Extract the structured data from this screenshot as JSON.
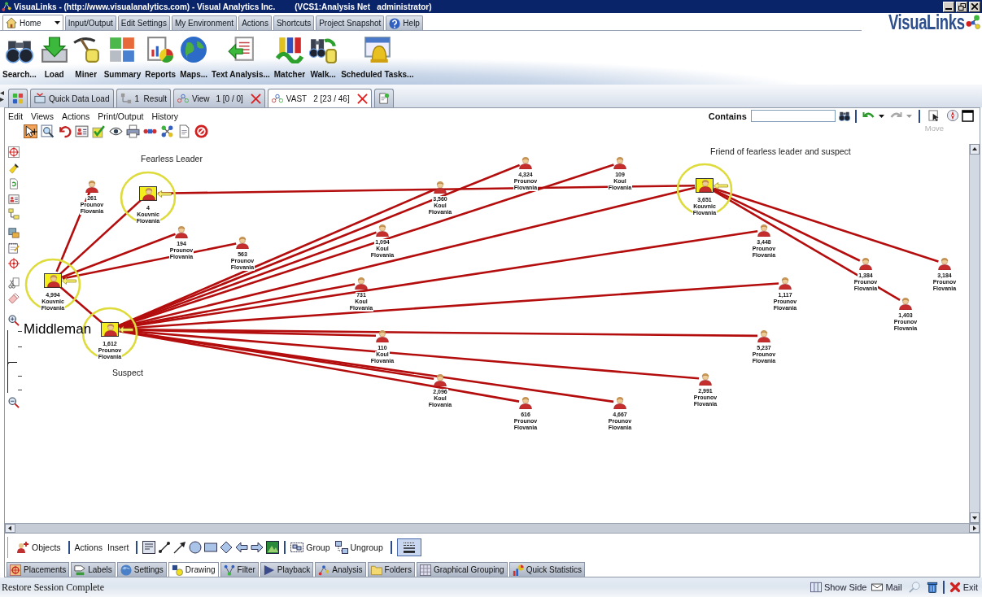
{
  "window": {
    "title": "VisuaLinks - (http://www.visualanalytics.com) - Visual Analytics Inc.",
    "session": "(VCS1:Analysis Net   administrator)"
  },
  "menu_tabs": [
    {
      "label": "Home",
      "kind": "home",
      "selected": true
    },
    {
      "label": "Input/Output",
      "kind": "plain",
      "selected": false
    },
    {
      "label": "Edit Settings",
      "kind": "plain",
      "selected": false
    },
    {
      "label": "My Environment",
      "kind": "plain",
      "selected": false
    },
    {
      "label": "Actions",
      "kind": "plain",
      "selected": false
    },
    {
      "label": "Shortcuts",
      "kind": "plain",
      "selected": false
    },
    {
      "label": "Project Snapshot",
      "kind": "plain",
      "selected": false
    },
    {
      "label": "Help",
      "kind": "help",
      "selected": false
    }
  ],
  "logo": "VisuaLinks",
  "ribbon": [
    {
      "label": "Search..."
    },
    {
      "label": "Load"
    },
    {
      "label": "Miner"
    },
    {
      "label": "Summary"
    },
    {
      "label": "Reports"
    },
    {
      "label": "Maps..."
    },
    {
      "label": "Text Analysis..."
    },
    {
      "label": "Matcher"
    },
    {
      "label": "Walk..."
    },
    {
      "label": "Scheduled Tasks..."
    }
  ],
  "document_tabs": [
    {
      "kind": "overview",
      "selected": false,
      "closable": false
    },
    {
      "kind": "load",
      "label": "Quick Data Load",
      "selected": false,
      "closable": false
    },
    {
      "kind": "result",
      "label": "1  Result",
      "selected": false,
      "closable": false
    },
    {
      "kind": "graph",
      "label": "View",
      "detail": "1 [0 / 0]",
      "selected": false,
      "closable": true
    },
    {
      "kind": "graph",
      "label": "VAST",
      "detail": "2 [23 / 46]",
      "selected": true,
      "closable": true
    },
    {
      "kind": "new",
      "selected": false,
      "closable": false
    }
  ],
  "graph_panel": {
    "menu": [
      "Edit",
      "Views",
      "Actions",
      "Print/Output",
      "History"
    ],
    "tools": [
      {
        "selected": true
      },
      {
        "selected": false
      },
      {
        "selected": false
      },
      {
        "selected": false
      },
      {
        "selected": false
      },
      {
        "selected": false
      },
      {
        "selected": false
      },
      {
        "selected": false
      },
      {
        "selected": false
      },
      {
        "selected": false
      },
      {
        "selected": false
      }
    ],
    "search": {
      "label": "Contains"
    },
    "history": [
      {
        "kind": "undo",
        "disabled": false
      },
      {
        "kind": "redo",
        "disabled": true
      }
    ],
    "move_button": {
      "label": "Move",
      "disabled": true
    },
    "zoom_slider": {
      "level": 0.46
    },
    "nodes": [
      {
        "value": "4,324",
        "name": "Prounov",
        "country": "Flovania",
        "selected": false
      },
      {
        "value": "109",
        "name": "Koul",
        "country": "Flovania",
        "selected": false
      },
      {
        "value": "261",
        "name": "Prounov",
        "country": "Flovania",
        "selected": false
      },
      {
        "value": "4",
        "name": "Kouvnic",
        "country": "Flovania",
        "selected": true
      },
      {
        "value": "3,560",
        "name": "Koul",
        "country": "Flovania",
        "selected": false
      },
      {
        "value": "3,651",
        "name": "Kouvnic",
        "country": "Flovania",
        "selected": true
      },
      {
        "value": "194",
        "name": "Prounov",
        "country": "Flovania",
        "selected": false
      },
      {
        "value": "563",
        "name": "Prounov",
        "country": "Flovania",
        "selected": false
      },
      {
        "value": "1,094",
        "name": "Koul",
        "country": "Flovania",
        "selected": false
      },
      {
        "value": "3,448",
        "name": "Prounov",
        "country": "Flovania",
        "selected": false
      },
      {
        "value": "1,384",
        "name": "Prounov",
        "country": "Flovania",
        "selected": false
      },
      {
        "value": "3,184",
        "name": "Prounov",
        "country": "Flovania",
        "selected": false
      },
      {
        "value": "4,994",
        "name": "Kouvnic",
        "country": "Flovania",
        "selected": true
      },
      {
        "value": "731",
        "name": "Koul",
        "country": "Flovania",
        "selected": false
      },
      {
        "value": "1,117",
        "name": "Prounov",
        "country": "Flovania",
        "selected": false
      },
      {
        "value": "1,403",
        "name": "Prounov",
        "country": "Flovania",
        "selected": false
      },
      {
        "value": "1,612",
        "name": "Prounov",
        "country": "Flovania",
        "selected": true
      },
      {
        "value": "110",
        "name": "Koul",
        "country": "Flovania",
        "selected": false
      },
      {
        "value": "5,237",
        "name": "Prounov",
        "country": "Flovania",
        "selected": false
      },
      {
        "value": "2,096",
        "name": "Koul",
        "country": "Flovania",
        "selected": false
      },
      {
        "value": "2,991",
        "name": "Prounov",
        "country": "Flovania",
        "selected": false
      },
      {
        "value": "616",
        "name": "Prounov",
        "country": "Flovania",
        "selected": false
      },
      {
        "value": "4,667",
        "name": "Prounov",
        "country": "Flovania",
        "selected": false
      }
    ],
    "notes": [
      {
        "text": "Fearless Leader"
      },
      {
        "text": "Friend of fearless leader and suspect"
      },
      {
        "text": "Middleman"
      },
      {
        "text": "Suspect"
      }
    ],
    "drawing_toolbar": {
      "menus": [
        "Objects",
        "Actions",
        "Insert"
      ],
      "group_buttons": [
        "Group",
        "Ungroup"
      ],
      "line_style": {
        "selected": true
      }
    },
    "bottom_tabs": [
      {
        "label": "Placements",
        "selected": false
      },
      {
        "label": "Labels",
        "selected": false
      },
      {
        "label": "Settings",
        "selected": false
      },
      {
        "label": "Drawing",
        "selected": true
      },
      {
        "label": "Filter",
        "selected": false
      },
      {
        "label": "Playback",
        "selected": false
      },
      {
        "label": "Analysis",
        "selected": false
      },
      {
        "label": "Folders",
        "selected": false
      },
      {
        "label": "Graphical Grouping",
        "selected": false
      },
      {
        "label": "Quick Statistics",
        "selected": false
      }
    ]
  },
  "status_bar": {
    "message": "Restore Session Complete",
    "items": [
      {
        "kind": "panel",
        "label": "Show Side"
      },
      {
        "kind": "mail",
        "label": "Mail"
      },
      {
        "kind": "search"
      },
      {
        "kind": "trash"
      },
      {
        "kind": "exit",
        "label": "Exit"
      }
    ]
  }
}
